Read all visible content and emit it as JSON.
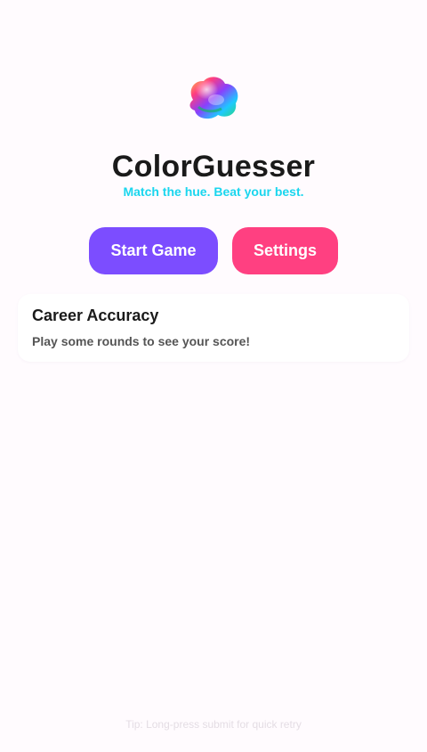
{
  "app": {
    "logo_icon": "iridescent-blob-icon",
    "title": "ColorGuesser",
    "subtitle": "Match the hue. Beat your best."
  },
  "actions": {
    "start_label": "Start Game",
    "settings_label": "Settings"
  },
  "career": {
    "title": "Career Accuracy",
    "message": "Play some rounds to see your score!"
  },
  "footer": {
    "tip": "Tip: Long-press submit for quick retry"
  },
  "colors": {
    "background": "#fffbfe",
    "title": "#1a1a1a",
    "subtitle": "#1ad6ee",
    "start_button": "#7c4dff",
    "settings_button": "#ff4081",
    "card_background": "#ffffff",
    "card_text": "#555555",
    "tip_text": "#e4dde4"
  }
}
